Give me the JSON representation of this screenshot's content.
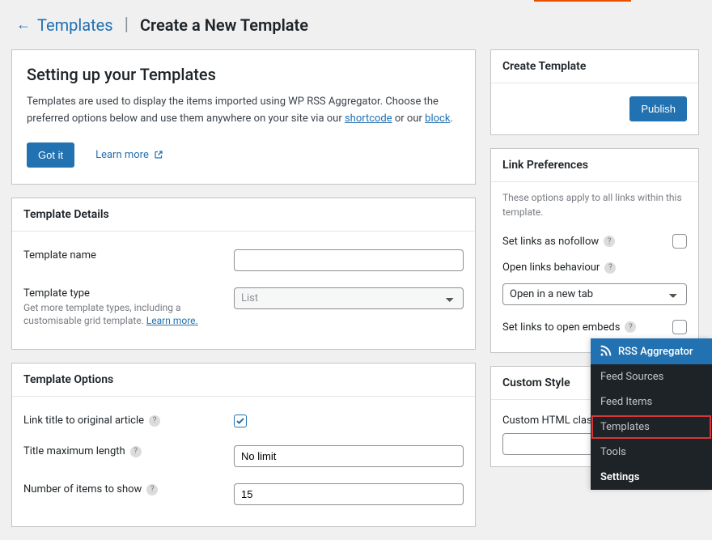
{
  "header": {
    "back_link": "Templates",
    "page_title": "Create a New Template"
  },
  "intro": {
    "title": "Setting up your Templates",
    "text_before": "Templates are used to display the items imported using WP RSS Aggregator. Choose the preferred options below and use them anywhere on your site via our ",
    "link1": "shortcode",
    "text_middle": " or our ",
    "link2": "block",
    "text_after": ".",
    "got_it": "Got it",
    "learn_more": "Learn more"
  },
  "template_details": {
    "header": "Template Details",
    "name_label": "Template name",
    "name_value": "",
    "type_label": "Template type",
    "type_help_before": "Get more template types, including a customisable grid template. ",
    "type_help_link": "Learn more.",
    "type_value": "List"
  },
  "template_options": {
    "header": "Template Options",
    "link_title_label": "Link title to original article",
    "title_max_label": "Title maximum length",
    "title_max_value": "No limit",
    "num_items_label": "Number of items to show",
    "num_items_value": "15"
  },
  "sidebar": {
    "create": {
      "header": "Create Template",
      "publish": "Publish"
    },
    "link_prefs": {
      "header": "Link Preferences",
      "desc": "These options apply to all links within this template.",
      "nofollow_label": "Set links as nofollow",
      "behaviour_label": "Open links behaviour",
      "behaviour_value": "Open in a new tab",
      "embeds_label": "Set links to open embeds"
    },
    "custom_style": {
      "header": "Custom Style",
      "html_class_label": "Custom HTML class",
      "html_class_value": ""
    }
  },
  "admin_menu": {
    "title": "RSS Aggregator",
    "items": [
      {
        "label": "Feed Sources",
        "highlight": false,
        "bold": false
      },
      {
        "label": "Feed Items",
        "highlight": false,
        "bold": false
      },
      {
        "label": "Templates",
        "highlight": true,
        "bold": false
      },
      {
        "label": "Tools",
        "highlight": false,
        "bold": false
      },
      {
        "label": "Settings",
        "highlight": false,
        "bold": true
      }
    ]
  }
}
